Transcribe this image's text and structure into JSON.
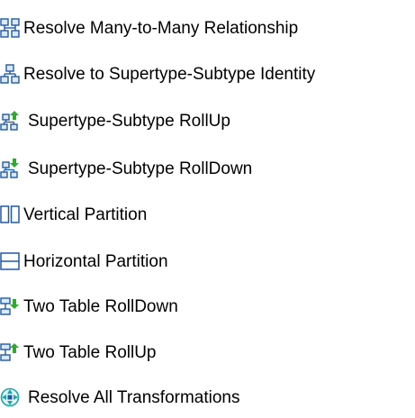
{
  "menu": {
    "items": [
      {
        "label": "Resolve Many-to-Many Relationship",
        "icon": "many-to-many-entities-icon"
      },
      {
        "label": "Resolve to Supertype-Subtype Identity",
        "icon": "supertype-subtype-hierarchy-icon"
      },
      {
        "label": "Supertype-Subtype RollUp",
        "icon": "supertype-rollup-icon"
      },
      {
        "label": "Supertype-Subtype RollDown",
        "icon": "supertype-rolldown-icon"
      },
      {
        "label": "Vertical Partition",
        "icon": "vertical-partition-icon"
      },
      {
        "label": "Horizontal Partition",
        "icon": "horizontal-partition-icon"
      },
      {
        "label": "Two Table RollDown",
        "icon": "two-table-rolldown-icon"
      },
      {
        "label": "Two Table RollUp",
        "icon": "two-table-rollup-icon"
      },
      {
        "label": "Resolve All Transformations",
        "icon": "resolve-all-icon"
      }
    ]
  },
  "colors": {
    "icon_stroke": "#1f5aa6",
    "icon_fill": "#dbe8f8",
    "arrow_green": "#2eaa2e",
    "resolve_all_teal": "#1aa7a7"
  }
}
